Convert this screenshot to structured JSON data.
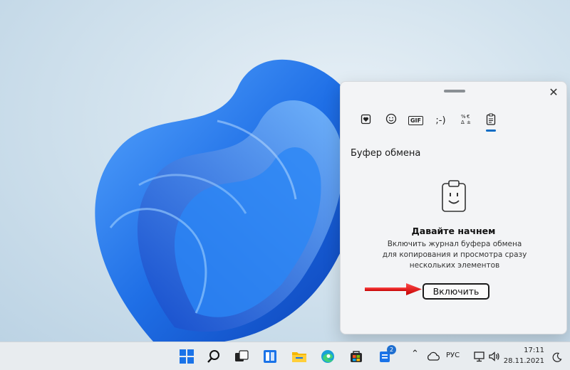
{
  "panel": {
    "tabs": [
      {
        "name": "heart-icon"
      },
      {
        "name": "emoji-icon"
      },
      {
        "name": "gif-icon",
        "label": "GIF"
      },
      {
        "name": "kaomoji-icon",
        "label": ";-)"
      },
      {
        "name": "symbols-icon"
      },
      {
        "name": "clipboard-icon"
      }
    ],
    "section_title": "Буфер обмена",
    "heading": "Давайте начнем",
    "description": "Включить журнал буфера обмена для копирования и просмотра сразу нескольких элементов",
    "enable_button": "Включить",
    "close_label": "✕"
  },
  "taskbar": {
    "store_badge": "2",
    "language": "РУС",
    "time": "17:11",
    "date": "28.11.2021"
  },
  "colors": {
    "accent": "#0a6bc4",
    "bloom": "#1f74e6"
  }
}
